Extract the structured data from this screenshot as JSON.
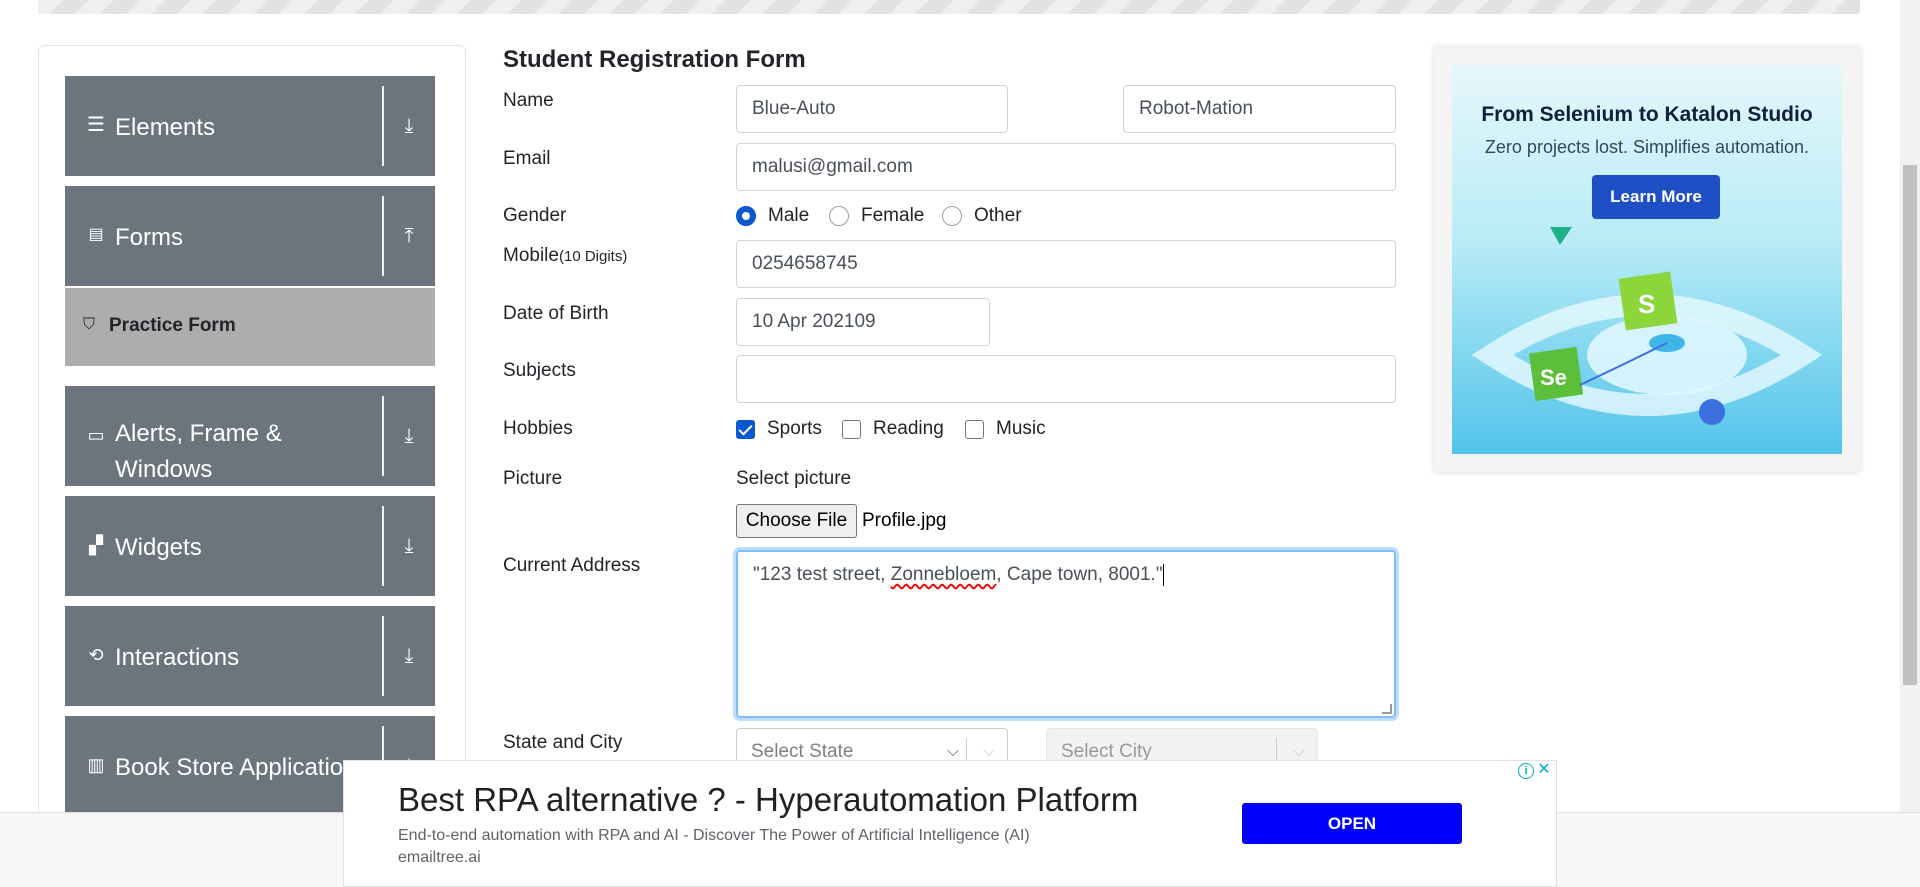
{
  "sidebar": {
    "groups": [
      {
        "label": "Elements",
        "icon": "hamburger-icon",
        "arrow": "download-icon"
      },
      {
        "label": "Forms",
        "icon": "document-icon",
        "arrow": "upload-icon"
      },
      {
        "label": "Alerts, Frame &",
        "label2": "Windows",
        "icon": "window-icon",
        "arrow": "download-icon"
      },
      {
        "label": "Widgets",
        "icon": "widgets-icon",
        "arrow": "download-icon"
      },
      {
        "label": "Interactions",
        "icon": "interactions-icon",
        "arrow": "download-icon"
      },
      {
        "label": "Book Store Applicatio",
        "icon": "books-icon",
        "arrow": "download-icon"
      }
    ],
    "active_item": "Practice Form"
  },
  "form": {
    "title": "Student Registration Form",
    "name_label": "Name",
    "first_name": "Blue-Auto",
    "last_name": "Robot-Mation",
    "email_label": "Email",
    "email": "malusi@gmail.com",
    "gender_label": "Gender",
    "gender_options": [
      "Male",
      "Female",
      "Other"
    ],
    "gender_selected": "Male",
    "mobile_label": "Mobile",
    "mobile_hint": "(10 Digits)",
    "mobile": "0254658745",
    "dob_label": "Date of Birth",
    "dob": "10 Apr 202109",
    "subjects_label": "Subjects",
    "hobbies_label": "Hobbies",
    "hobbies": [
      "Sports",
      "Reading",
      "Music"
    ],
    "hobbies_checked": [
      "Sports"
    ],
    "picture_label": "Picture",
    "picture_prompt": "Select picture",
    "choose_file": "Choose File",
    "file_name": "Profile.jpg",
    "address_label": "Current Address",
    "address_part1": "\"123 test street, ",
    "address_misspelled": "Zonnebloem",
    "address_part2": ", Cape town, 8001.\"",
    "state_city_label": "State and City",
    "state_placeholder": "Select State",
    "city_placeholder": "Select City"
  },
  "ad_right": {
    "title": "From Selenium to Katalon Studio",
    "subtitle": "Zero projects lost. Simplifies automation.",
    "button": "Learn More",
    "badge_s": "S",
    "badge_se": "Se"
  },
  "ad_bottom": {
    "title": "Best RPA alternative ? - Hyperautomation Platform",
    "description": "End-to-end automation with RPA and AI - Discover The Power of Artificial Intelligence (AI)",
    "url": "emailtree.ai",
    "button": "OPEN"
  },
  "colors": {
    "sidebar": "#6c757d",
    "accent": "#0b57d0",
    "ad_button": "#0000ff"
  }
}
